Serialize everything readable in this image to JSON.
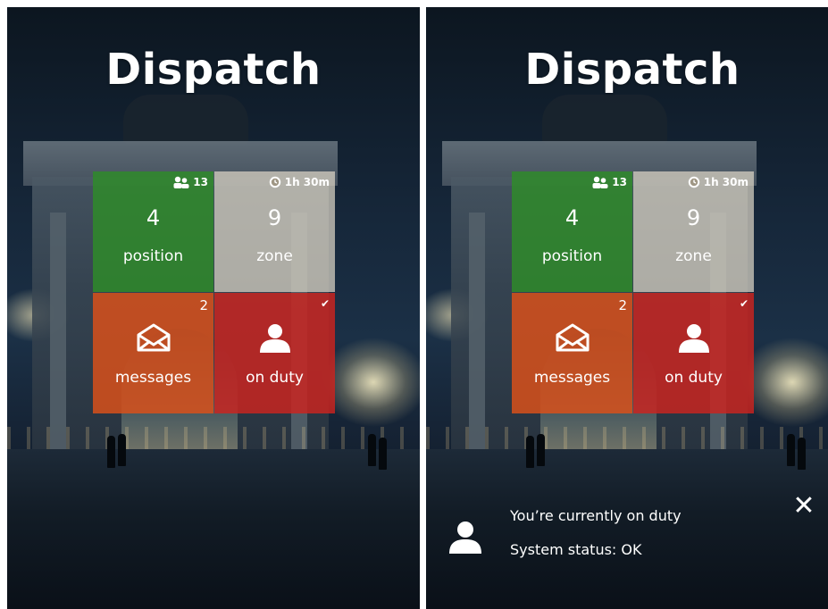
{
  "app": {
    "title": "Dispatch"
  },
  "tiles": {
    "position": {
      "number": "4",
      "label": "position",
      "badge": "13",
      "badge_icon": "people-icon",
      "color": "#2E8C28"
    },
    "zone": {
      "number": "9",
      "label": "zone",
      "badge": "1h 30m",
      "badge_icon": "clock-icon",
      "color": "#DCD6C6"
    },
    "messages": {
      "label": "messages",
      "badge": "2",
      "icon": "envelope-icon",
      "color": "#DE5019"
    },
    "on_duty": {
      "label": "on duty",
      "badge": "✔",
      "icon": "person-icon",
      "color": "#CD231E"
    }
  },
  "notification": {
    "line1": "You’re currently on duty",
    "line2": "System status: OK",
    "icon": "person-icon",
    "close_label": "✕"
  }
}
